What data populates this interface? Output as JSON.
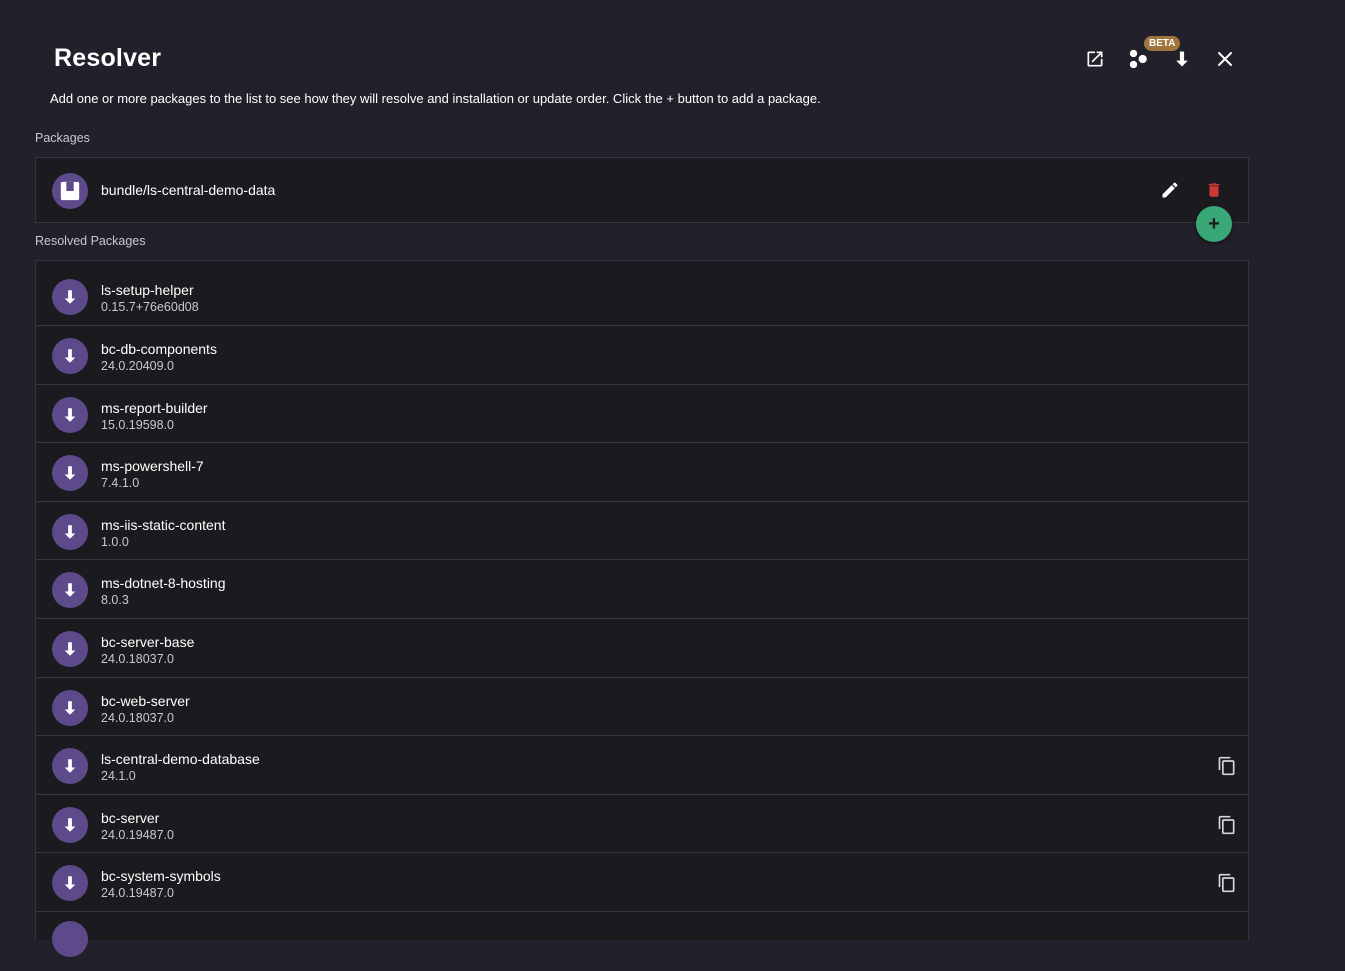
{
  "header": {
    "title": "Resolver",
    "subtitle": "Add one or more packages to the list to see how they will resolve and installation or update order. Click the + button to add a package.",
    "toolbar": {
      "open_icon": "open-in-new-icon",
      "dependencies_icon": "dependencies-icon",
      "beta_badge": "BETA",
      "download_icon": "download-icon",
      "close_icon": "close-icon"
    }
  },
  "packages": {
    "label": "Packages",
    "items": [
      {
        "name": "bundle/ls-central-demo-data",
        "icon": "package-icon"
      }
    ],
    "add_button": "+"
  },
  "resolved": {
    "label": "Resolved Packages",
    "items": [
      {
        "name": "ls-setup-helper",
        "version": "0.15.7+76e60d08",
        "copy": false
      },
      {
        "name": "bc-db-components",
        "version": "24.0.20409.0",
        "copy": false
      },
      {
        "name": "ms-report-builder",
        "version": "15.0.19598.0",
        "copy": false
      },
      {
        "name": "ms-powershell-7",
        "version": "7.4.1.0",
        "copy": false
      },
      {
        "name": "ms-iis-static-content",
        "version": "1.0.0",
        "copy": false
      },
      {
        "name": "ms-dotnet-8-hosting",
        "version": "8.0.3",
        "copy": false
      },
      {
        "name": "bc-server-base",
        "version": "24.0.18037.0",
        "copy": false
      },
      {
        "name": "bc-web-server",
        "version": "24.0.18037.0",
        "copy": false
      },
      {
        "name": "ls-central-demo-database",
        "version": "24.1.0",
        "copy": true
      },
      {
        "name": "bc-server",
        "version": "24.0.19487.0",
        "copy": true
      },
      {
        "name": "bc-system-symbols",
        "version": "24.0.19487.0",
        "copy": true
      }
    ]
  },
  "colors": {
    "background": "#22212b",
    "panel": "#1b1b1f",
    "avatar": "#5d4a8a",
    "delete": "#d03a36",
    "fab": "#3aa876",
    "beta": "#a0743c"
  }
}
